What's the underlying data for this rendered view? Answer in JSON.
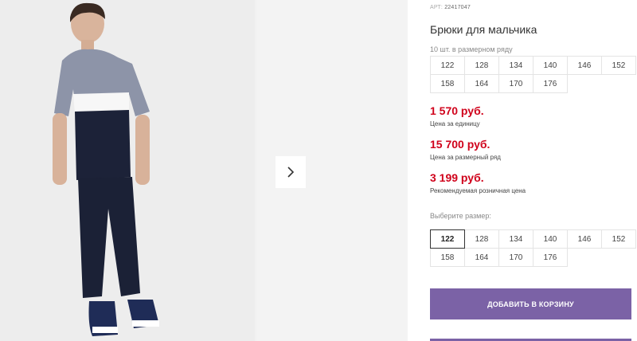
{
  "product": {
    "art_label": "АРТ:",
    "art_number": "22417047",
    "title": "Брюки для мальчика"
  },
  "pack": {
    "label": "10 шт. в размерном ряду",
    "sizes": [
      "122",
      "128",
      "134",
      "140",
      "146",
      "152",
      "158",
      "164",
      "170",
      "176"
    ]
  },
  "prices": {
    "unit_price": "1 570 руб.",
    "unit_note": "Цена за единицу",
    "pack_price": "15 700 руб.",
    "pack_note": "Цена за размерный ряд",
    "retail_price": "3 199 руб.",
    "retail_note": "Рекомендуемая розничная цена"
  },
  "size_select": {
    "label": "Выберите размер:",
    "selected": "122",
    "sizes": [
      "122",
      "128",
      "134",
      "140",
      "146",
      "152",
      "158",
      "164",
      "170",
      "176"
    ]
  },
  "actions": {
    "add_to_cart": "ДОБАВИТЬ В КОРЗИНУ"
  },
  "gallery": {
    "next_icon": "chevron-right-icon"
  },
  "colors": {
    "price": "#d0021b",
    "button": "#7b62a6"
  }
}
